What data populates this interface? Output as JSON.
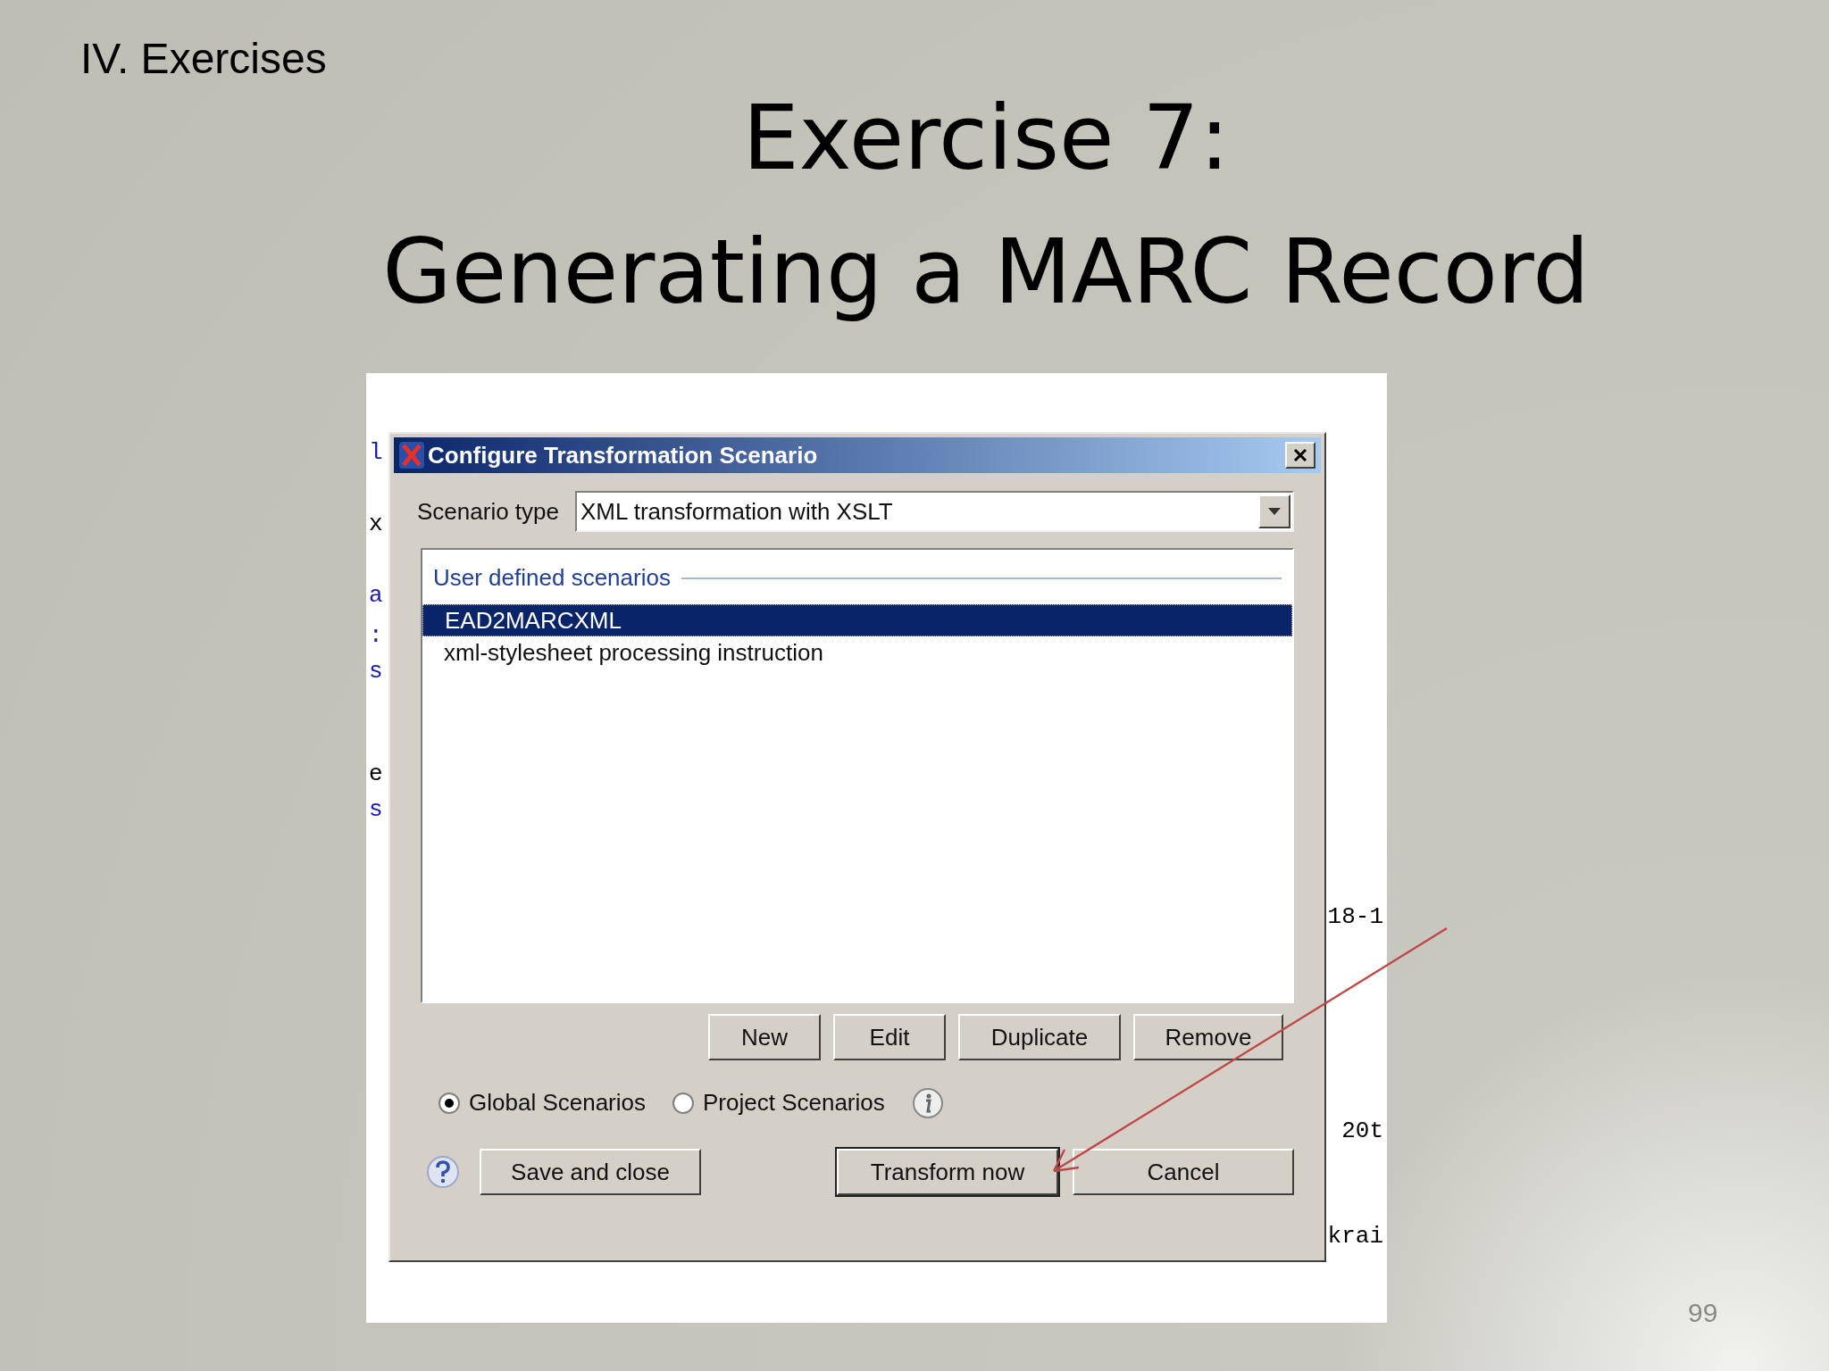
{
  "slide": {
    "section": "IV. Exercises",
    "title_lines": [
      "Exercise 7:",
      "Generating a MARC Record"
    ],
    "page_number": "99"
  },
  "left_fragments": [
    {
      "text": "l",
      "kind": "markup"
    },
    {
      "text": "x",
      "kind": "text"
    },
    {
      "text": "a",
      "kind": "markup"
    },
    {
      "text": ":",
      "kind": "markup"
    },
    {
      "text": "s",
      "kind": "markup"
    },
    {
      "text": "e",
      "kind": "text"
    },
    {
      "text": "s",
      "kind": "markup"
    }
  ],
  "right_fragments": [
    {
      "text": "18-1"
    },
    {
      "text": "20t"
    },
    {
      "text": "krai"
    }
  ],
  "dialog": {
    "title": "Configure Transformation Scenario",
    "scenario_type_label": "Scenario type",
    "scenario_type_value": "XML transformation with XSLT",
    "group_label": "User defined scenarios",
    "scenarios": [
      {
        "label": "EAD2MARCXML",
        "selected": true
      },
      {
        "label": "xml-stylesheet processing instruction",
        "selected": false
      }
    ],
    "list_buttons": [
      "New",
      "Edit",
      "Duplicate",
      "Remove"
    ],
    "scopes": [
      {
        "label": "Global Scenarios",
        "selected": true
      },
      {
        "label": "Project Scenarios",
        "selected": false
      }
    ],
    "left_button": "Save and close",
    "buttons": [
      {
        "label": "Transform now",
        "default": true
      },
      {
        "label": "Cancel",
        "default": false
      }
    ]
  }
}
